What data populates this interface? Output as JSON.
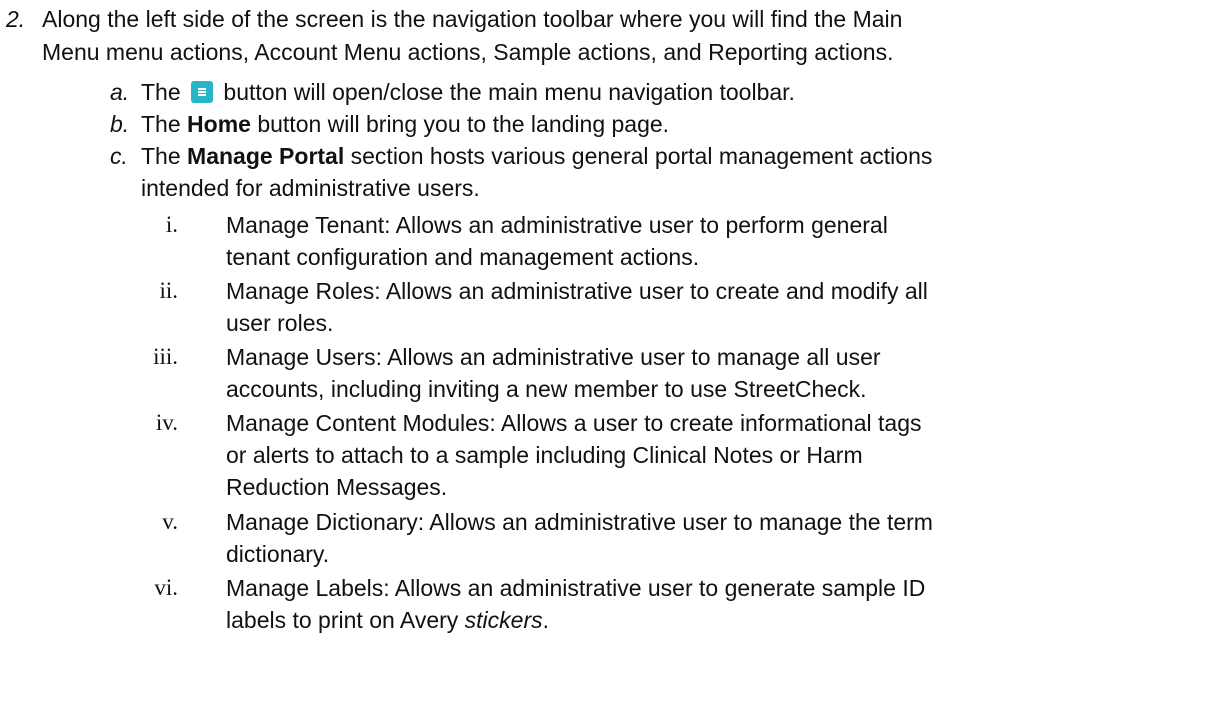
{
  "item2": {
    "marker": "2.",
    "line1": "Along the left side of the screen is the navigation toolbar where you will find the Main",
    "line2": "Menu menu actions, Account Menu actions, Sample actions, and Reporting actions."
  },
  "a": {
    "marker": "a.",
    "pre": "The",
    "icon": "menu-toggle-icon",
    "post": "button will open/close the main menu navigation toolbar."
  },
  "b": {
    "marker": "b.",
    "pre": "The ",
    "bold": "Home",
    "post": " button will bring you to the landing page."
  },
  "c": {
    "marker": "c.",
    "pre": "The ",
    "bold": "Manage Portal",
    "post": " section hosts various general portal management actions",
    "line2": "intended for administrative users."
  },
  "roman": [
    {
      "marker": "i.",
      "lines": [
        "Manage Tenant: Allows an administrative user to perform general",
        "tenant configuration and management actions."
      ]
    },
    {
      "marker": "ii.",
      "lines": [
        "Manage Roles: Allows an administrative user to create and modify all",
        "user roles."
      ]
    },
    {
      "marker": "iii.",
      "lines": [
        "Manage Users: Allows an administrative user to manage all user",
        "accounts, including inviting a new member to use StreetCheck."
      ]
    },
    {
      "marker": "iv.",
      "lines": [
        "Manage Content Modules: Allows a user to create informational tags",
        "or alerts to attach to a sample including Clinical Notes or Harm",
        "Reduction Messages."
      ]
    },
    {
      "marker": "v.",
      "lines": [
        "Manage Dictionary: Allows an administrative user to manage the term",
        "dictionary."
      ]
    }
  ],
  "vi": {
    "marker": "vi.",
    "line1": "Manage Labels: Allows an administrative user to generate sample ID",
    "line2_pre": "labels to print on Avery ",
    "line2_it": "stickers",
    "line2_post": "."
  },
  "colors": {
    "accent": "#26b5c9",
    "text": "#111111"
  }
}
